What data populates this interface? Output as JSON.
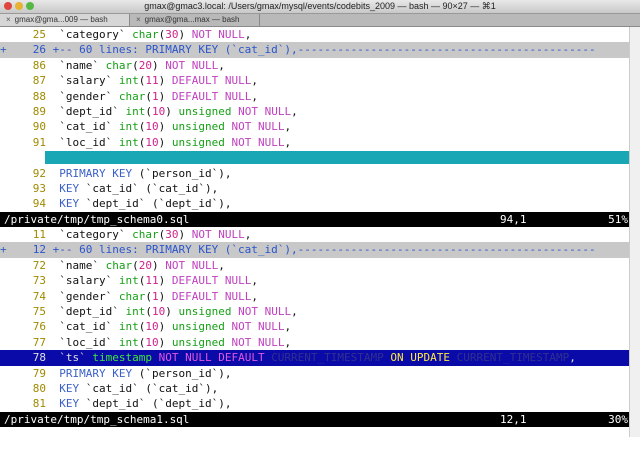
{
  "window": {
    "title": "gmax@gmac3.local: /Users/gmax/mysql/events/codebits_2009 — bash — 90×27 — ⌘1"
  },
  "tabs": [
    {
      "label": "gmax@gma...009 — bash"
    },
    {
      "label": "gmax@gma...max — bash"
    }
  ],
  "pane1": {
    "lines": [
      {
        "num": "25",
        "gutter": "",
        "text": "  `category` char(30) NOT NULL,"
      },
      {
        "num": "26",
        "gutter": "+",
        "text": " +-- 60 lines: PRIMARY KEY (`cat_id`),---------------------------------------------",
        "fold": true
      },
      {
        "num": "86",
        "gutter": "",
        "text": "  `name` char(20) NOT NULL,"
      },
      {
        "num": "87",
        "gutter": "",
        "text": "  `salary` int(11) DEFAULT NULL,"
      },
      {
        "num": "88",
        "gutter": "",
        "text": "  `gender` char(1) DEFAULT NULL,"
      },
      {
        "num": "89",
        "gutter": "",
        "text": "  `dept_id` int(10) unsigned NOT NULL,"
      },
      {
        "num": "90",
        "gutter": "",
        "text": "  `cat_id` int(10) unsigned NOT NULL,"
      },
      {
        "num": "91",
        "gutter": "",
        "text": "  `loc_id` int(10) unsigned NOT NULL,"
      },
      {
        "num": "",
        "gutter": "",
        "text": "",
        "cyan": true
      },
      {
        "num": "92",
        "gutter": "",
        "text": "  PRIMARY KEY (`person_id`),"
      },
      {
        "num": "93",
        "gutter": "",
        "text": "  KEY `cat_id` (`cat_id`),"
      },
      {
        "num": "94",
        "gutter": "",
        "text": "  KEY `dept_id` (`dept_id`),"
      }
    ],
    "status": {
      "file": "/private/tmp/tmp_schema0.sql",
      "pos": "94,1",
      "pct": "51%"
    }
  },
  "pane2": {
    "lines": [
      {
        "num": "11",
        "gutter": "",
        "text": "  `category` char(30) NOT NULL,"
      },
      {
        "num": "12",
        "gutter": "+",
        "text": " +-- 60 lines: PRIMARY KEY (`cat_id`),---------------------------------------------",
        "fold": true
      },
      {
        "num": "72",
        "gutter": "",
        "text": "  `name` char(20) NOT NULL,"
      },
      {
        "num": "73",
        "gutter": "",
        "text": "  `salary` int(11) DEFAULT NULL,"
      },
      {
        "num": "74",
        "gutter": "",
        "text": "  `gender` char(1) DEFAULT NULL,"
      },
      {
        "num": "75",
        "gutter": "",
        "text": "  `dept_id` int(10) unsigned NOT NULL,"
      },
      {
        "num": "76",
        "gutter": "",
        "text": "  `cat_id` int(10) unsigned NOT NULL,"
      },
      {
        "num": "77",
        "gutter": "",
        "text": "  `loc_id` int(10) unsigned NOT NULL,"
      },
      {
        "num": "78",
        "gutter": "",
        "text": "  `ts` timestamp NOT NULL DEFAULT CURRENT_TIMESTAMP ON UPDATE CURRENT_TIMESTAMP,",
        "highlight": true
      },
      {
        "num": "79",
        "gutter": "",
        "text": "  PRIMARY KEY (`person_id`),"
      },
      {
        "num": "80",
        "gutter": "",
        "text": "  KEY `cat_id` (`cat_id`),"
      },
      {
        "num": "81",
        "gutter": "",
        "text": "  KEY `dept_id` (`dept_id`),"
      }
    ],
    "status": {
      "file": "/private/tmp/tmp_schema1.sql",
      "pos": "12,1",
      "pct": "30%"
    }
  },
  "colors": {
    "fold_bg": "#c8c8c8",
    "cyan_filler": "#1aa7b5",
    "diff_highlight_bg": "#0a0aa8",
    "status_bg": "#000000"
  }
}
